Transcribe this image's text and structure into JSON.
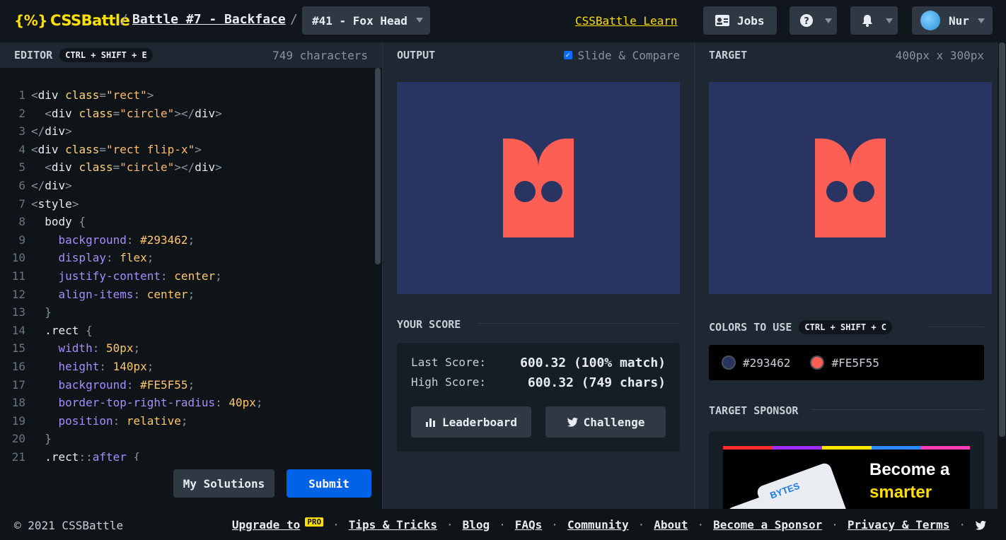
{
  "header": {
    "logo_text": "CSSBattle",
    "logo_mark": "{%}",
    "breadcrumb_battle": "Battle #7 - Backface",
    "level_select": "#41 - Fox Head",
    "learn_link": "CSSBattle Learn",
    "jobs_label": "Jobs",
    "user_name": "Nur"
  },
  "editor": {
    "title": "EDITOR",
    "shortcut": "CTRL + SHIFT + E",
    "char_count": "749 characters",
    "lines": [
      [
        [
          "<",
          "t-punc"
        ],
        [
          "div ",
          "t-tag"
        ],
        [
          "class",
          "t-attr"
        ],
        [
          "=",
          "t-punc"
        ],
        [
          "\"rect\"",
          "t-str"
        ],
        [
          ">",
          "t-punc"
        ]
      ],
      [
        [
          "  <",
          "t-punc"
        ],
        [
          "div ",
          "t-tag"
        ],
        [
          "class",
          "t-attr"
        ],
        [
          "=",
          "t-punc"
        ],
        [
          "\"circle\"",
          "t-str"
        ],
        [
          "></",
          "t-punc"
        ],
        [
          "div",
          "t-tag"
        ],
        [
          ">",
          "t-punc"
        ]
      ],
      [
        [
          "</",
          "t-punc"
        ],
        [
          "div",
          "t-tag"
        ],
        [
          ">",
          "t-punc"
        ]
      ],
      [
        [
          "<",
          "t-punc"
        ],
        [
          "div ",
          "t-tag"
        ],
        [
          "class",
          "t-attr"
        ],
        [
          "=",
          "t-punc"
        ],
        [
          "\"rect flip-x\"",
          "t-str"
        ],
        [
          ">",
          "t-punc"
        ]
      ],
      [
        [
          "  <",
          "t-punc"
        ],
        [
          "div ",
          "t-tag"
        ],
        [
          "class",
          "t-attr"
        ],
        [
          "=",
          "t-punc"
        ],
        [
          "\"circle\"",
          "t-str"
        ],
        [
          "></",
          "t-punc"
        ],
        [
          "div",
          "t-tag"
        ],
        [
          ">",
          "t-punc"
        ]
      ],
      [
        [
          "</",
          "t-punc"
        ],
        [
          "div",
          "t-tag"
        ],
        [
          ">",
          "t-punc"
        ]
      ],
      [
        [
          "<",
          "t-punc"
        ],
        [
          "style",
          "t-tag"
        ],
        [
          ">",
          "t-punc"
        ]
      ],
      [
        [
          "  body ",
          "t-sel"
        ],
        [
          "{",
          "t-punc"
        ]
      ],
      [
        [
          "    background",
          "t-prop"
        ],
        [
          ": ",
          "t-punc"
        ],
        [
          "#293462",
          "t-val"
        ],
        [
          ";",
          "t-punc"
        ]
      ],
      [
        [
          "    display",
          "t-prop"
        ],
        [
          ": ",
          "t-punc"
        ],
        [
          "flex",
          "t-val"
        ],
        [
          ";",
          "t-punc"
        ]
      ],
      [
        [
          "    justify-content",
          "t-prop"
        ],
        [
          ": ",
          "t-punc"
        ],
        [
          "center",
          "t-val"
        ],
        [
          ";",
          "t-punc"
        ]
      ],
      [
        [
          "    align-items",
          "t-prop"
        ],
        [
          ": ",
          "t-punc"
        ],
        [
          "center",
          "t-val"
        ],
        [
          ";",
          "t-punc"
        ]
      ],
      [
        [
          "  }",
          "t-punc"
        ]
      ],
      [
        [
          "  .rect ",
          "t-sel"
        ],
        [
          "{",
          "t-punc"
        ]
      ],
      [
        [
          "    width",
          "t-prop"
        ],
        [
          ": ",
          "t-punc"
        ],
        [
          "50px",
          "t-val"
        ],
        [
          ";",
          "t-punc"
        ]
      ],
      [
        [
          "    height",
          "t-prop"
        ],
        [
          ": ",
          "t-punc"
        ],
        [
          "140px",
          "t-val"
        ],
        [
          ";",
          "t-punc"
        ]
      ],
      [
        [
          "    background",
          "t-prop"
        ],
        [
          ": ",
          "t-punc"
        ],
        [
          "#FE5F55",
          "t-val"
        ],
        [
          ";",
          "t-punc"
        ]
      ],
      [
        [
          "    border-top-right-radius",
          "t-prop"
        ],
        [
          ": ",
          "t-punc"
        ],
        [
          "40px",
          "t-val"
        ],
        [
          ";",
          "t-punc"
        ]
      ],
      [
        [
          "    position",
          "t-prop"
        ],
        [
          ": ",
          "t-punc"
        ],
        [
          "relative",
          "t-val"
        ],
        [
          ";",
          "t-punc"
        ]
      ],
      [
        [
          "  }",
          "t-punc"
        ]
      ],
      [
        [
          "  .rect",
          "t-sel"
        ],
        [
          "::",
          "t-punc"
        ],
        [
          "after ",
          "t-prop"
        ],
        [
          "{",
          "t-punc"
        ]
      ]
    ],
    "my_solutions_label": "My Solutions",
    "submit_label": "Submit"
  },
  "output": {
    "title": "OUTPUT",
    "slide_compare_label": "Slide & Compare",
    "slide_compare_checked": true,
    "your_score_title": "YOUR SCORE",
    "last_score_label": "Last Score:",
    "last_score_value": "600.32 (100% match)",
    "high_score_label": "High Score:",
    "high_score_value": "600.32 (749 chars)",
    "leaderboard_label": "Leaderboard",
    "challenge_label": "Challenge"
  },
  "target": {
    "title": "TARGET",
    "size": "400px x 300px",
    "colors_title": "COLORS TO USE",
    "colors_shortcut": "CTRL + SHIFT + C",
    "colors": [
      "#293462",
      "#FE5F55"
    ],
    "sponsor_title": "TARGET SPONSOR",
    "sponsor_line1": "Become a",
    "sponsor_line2": "smarter",
    "sponsor_brand": "BYTES"
  },
  "footer": {
    "copyright": "© 2021 CSSBattle",
    "links": [
      "Upgrade to",
      "Tips & Tricks",
      "Blog",
      "FAQs",
      "Community",
      "About",
      "Become a Sponsor",
      "Privacy & Terms"
    ],
    "pro_badge": "PRO"
  },
  "colors": {
    "bg_canvas": "#293462",
    "shape": "#FE5F55",
    "brand_yellow": "#ffdf00",
    "submit_blue": "#0062e6"
  }
}
